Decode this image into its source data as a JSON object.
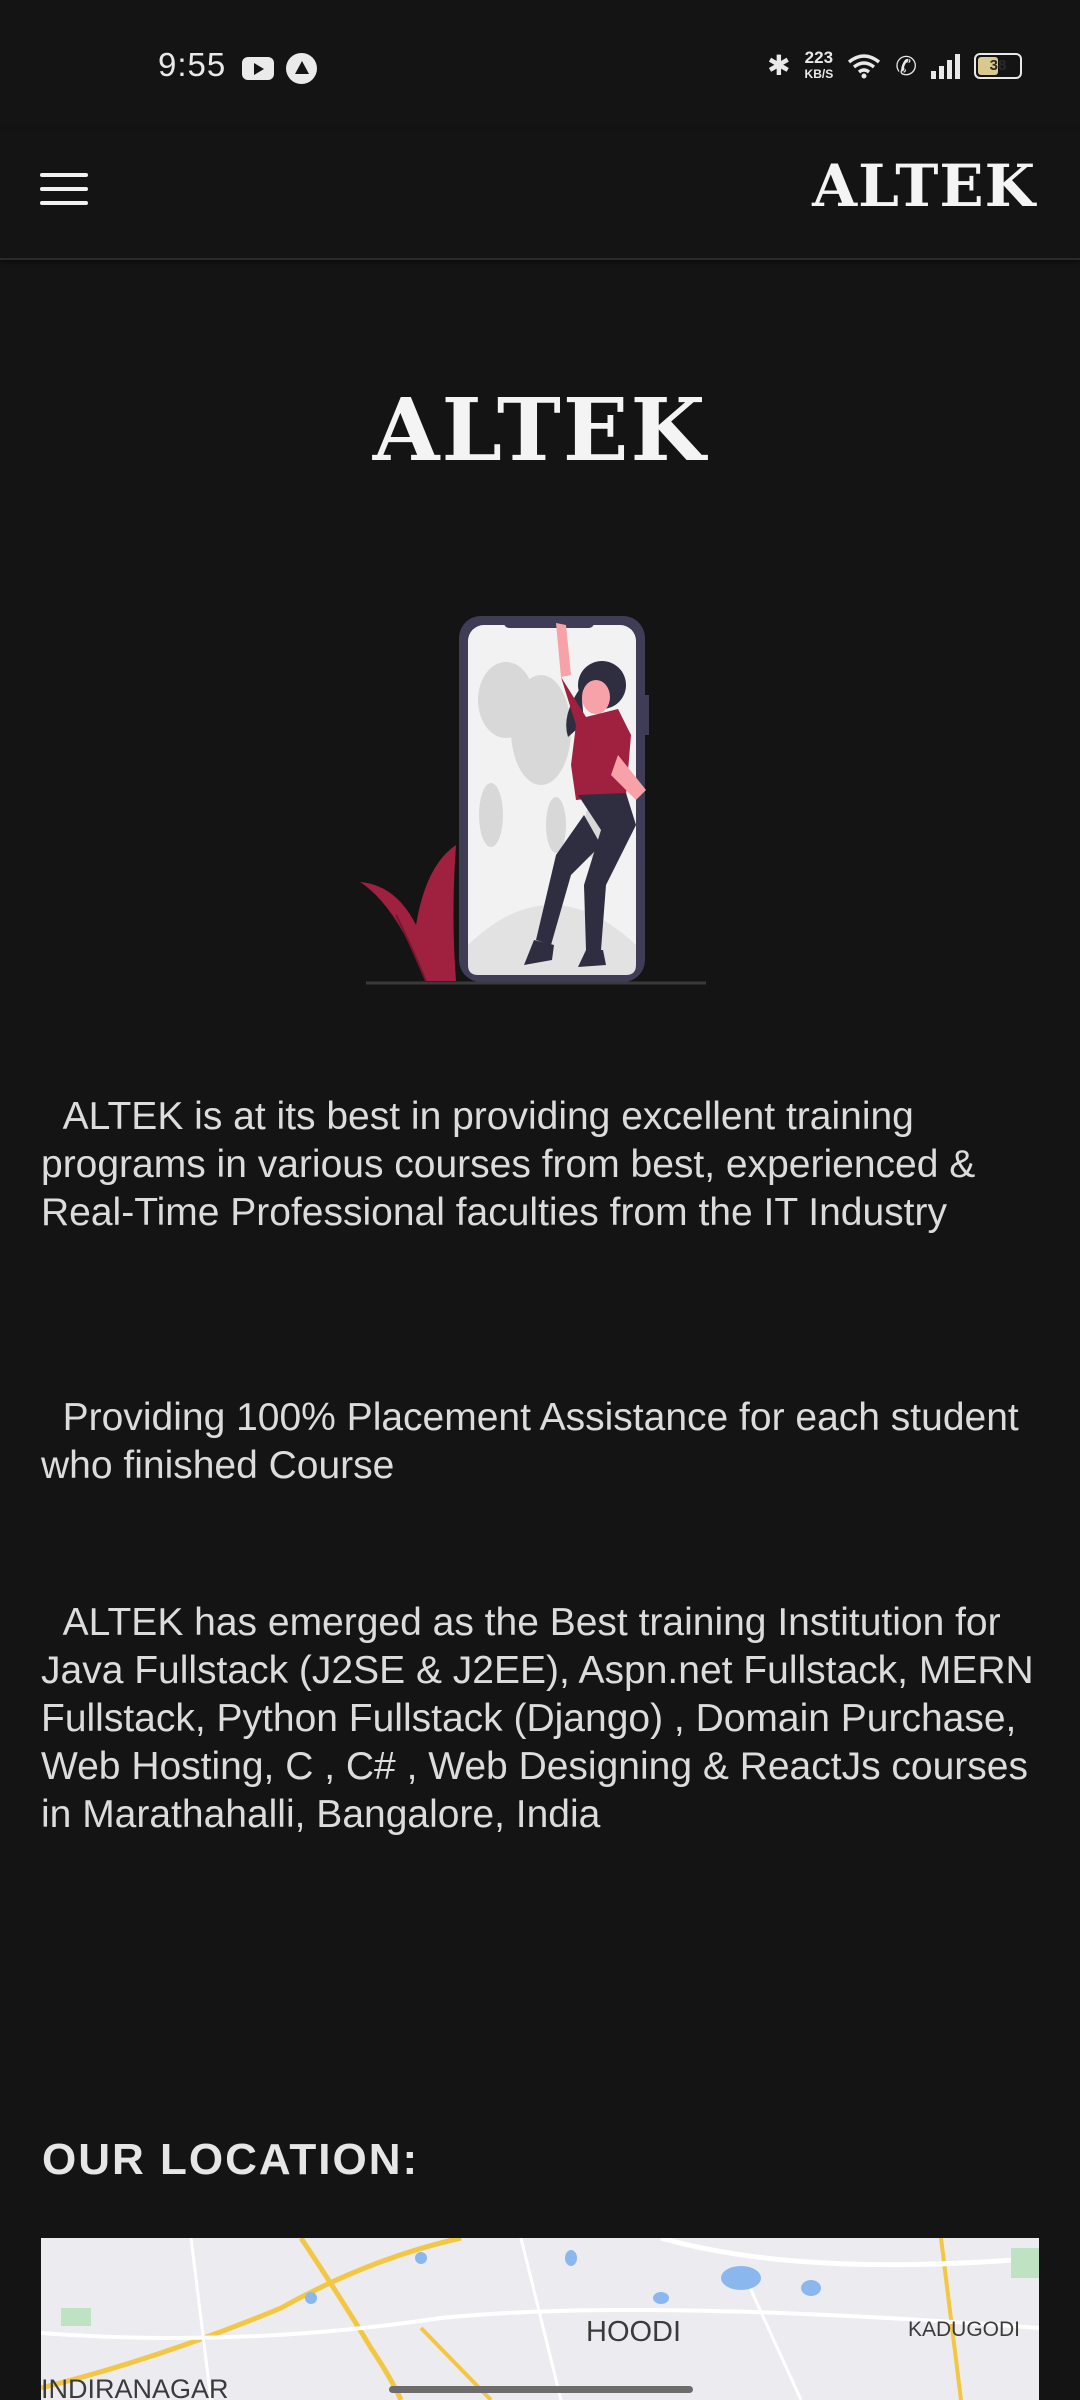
{
  "status_bar": {
    "time": "9:55",
    "net_speed_value": "223",
    "net_speed_unit": "KB/S",
    "battery": "38",
    "icons": [
      "youtube-icon",
      "app-icon",
      "bluetooth-icon",
      "wifi-icon",
      "call-icon",
      "signal-icon",
      "battery-icon"
    ]
  },
  "header": {
    "menu_icon": "hamburger-menu-icon",
    "logo": "ALTEK"
  },
  "hero": {
    "logo": "ALTEK",
    "illustration": "woman-in-phone-illustration"
  },
  "content": {
    "para1": "  ALTEK is at its best in providing excellent training programs in various courses from best, experienced & Real-Time Professional faculties from the IT Industry",
    "para2": "  Providing 100% Placement Assistance for each student who finished Course",
    "para3": "  ALTEK has emerged as the Best training Institution for Java Fullstack (J2SE & J2EE), Aspn.net Fullstack, MERN Fullstack, Python Fullstack (Django) , Domain Purchase, Web Hosting, C , C# , Web Designing & ReactJs courses in Marathahalli, Bangalore, India"
  },
  "location": {
    "title": "OUR LOCATION:",
    "map_labels": {
      "hoodi": "HOODI",
      "kadugodi": "KADUGODI",
      "indiranagar": "INDIRANAGAR"
    }
  },
  "colors": {
    "background": "#141415",
    "accent": "#a0203f",
    "text": "#dcdcdc"
  }
}
